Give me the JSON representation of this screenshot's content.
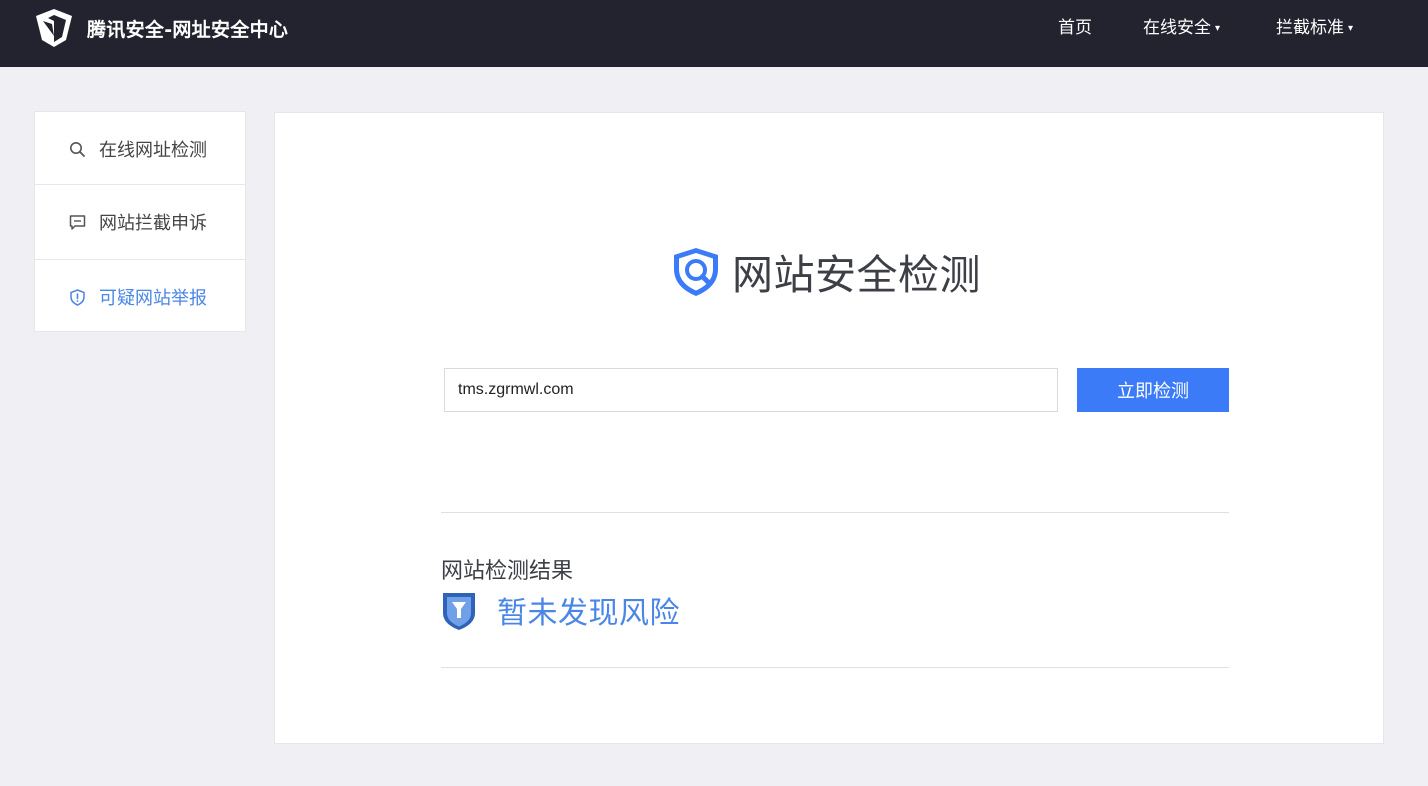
{
  "header": {
    "title": "腾讯安全-网址安全中心",
    "logo_icon": "tencent-security-logo-icon",
    "nav": [
      {
        "label": "首页"
      },
      {
        "label": "在线安全",
        "caret": "▾"
      },
      {
        "label": "拦截标准",
        "caret": "▾"
      }
    ]
  },
  "sidebar": {
    "items": [
      {
        "label": "在线网址检测",
        "icon": "search-icon",
        "active": false
      },
      {
        "label": "网站拦截申诉",
        "icon": "comment-icon",
        "active": false
      },
      {
        "label": "可疑网站举报",
        "icon": "shield-alert-icon",
        "active": true
      }
    ]
  },
  "main": {
    "hero_title": "网站安全检测",
    "hero_icon": "shield-search-icon",
    "url_input": {
      "value": "tms.zgrmwl.com",
      "placeholder": ""
    },
    "check_button": "立即检测",
    "result": {
      "title": "网站检测结果",
      "status_icon": "safe-shield-icon",
      "status_text": "暂未发现风险"
    }
  },
  "colors": {
    "topbar_bg": "#22232f",
    "page_bg": "#efeff4",
    "accent": "#3b7bf7",
    "link_blue": "#4a86e8",
    "text_dark": "#3d3f46"
  }
}
